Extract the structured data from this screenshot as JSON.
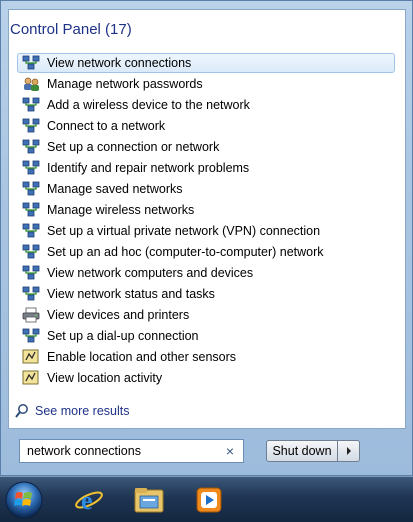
{
  "start_menu": {
    "group_header": "Control Panel (17)",
    "results": [
      {
        "label": "View network connections",
        "icon": "network-icon",
        "selected": true
      },
      {
        "label": "Manage network passwords",
        "icon": "credentials-icon"
      },
      {
        "label": "Add a wireless device to the network",
        "icon": "network-icon"
      },
      {
        "label": "Connect to a network",
        "icon": "network-icon"
      },
      {
        "label": "Set up a connection or network",
        "icon": "network-icon"
      },
      {
        "label": "Identify and repair network problems",
        "icon": "network-icon"
      },
      {
        "label": "Manage saved networks",
        "icon": "network-icon"
      },
      {
        "label": "Manage wireless networks",
        "icon": "network-icon"
      },
      {
        "label": "Set up a virtual private network (VPN) connection",
        "icon": "network-icon"
      },
      {
        "label": "Set up an ad hoc (computer-to-computer) network",
        "icon": "network-icon"
      },
      {
        "label": "View network computers and devices",
        "icon": "network-icon"
      },
      {
        "label": "View network status and tasks",
        "icon": "network-icon"
      },
      {
        "label": "View devices and printers",
        "icon": "printer-icon"
      },
      {
        "label": "Set up a dial-up connection",
        "icon": "network-icon"
      },
      {
        "label": "Enable location and other sensors",
        "icon": "sensor-icon"
      },
      {
        "label": "View location activity",
        "icon": "sensor-icon"
      }
    ],
    "see_more": "See more results",
    "search": {
      "value": "network connections",
      "clear_glyph": "×"
    },
    "shutdown_label": "Shut down"
  },
  "taskbar": {
    "items": [
      {
        "name": "start-button",
        "icon": "windows-orb-icon"
      },
      {
        "name": "internet-explorer",
        "icon": "internet-explorer-icon"
      },
      {
        "name": "windows-explorer",
        "icon": "folder-icon"
      },
      {
        "name": "media-player",
        "icon": "media-player-icon"
      }
    ]
  },
  "colors": {
    "header_text": "#1e3287",
    "selection_border": "#9ec3e6",
    "taskbar": "#1f3553"
  }
}
